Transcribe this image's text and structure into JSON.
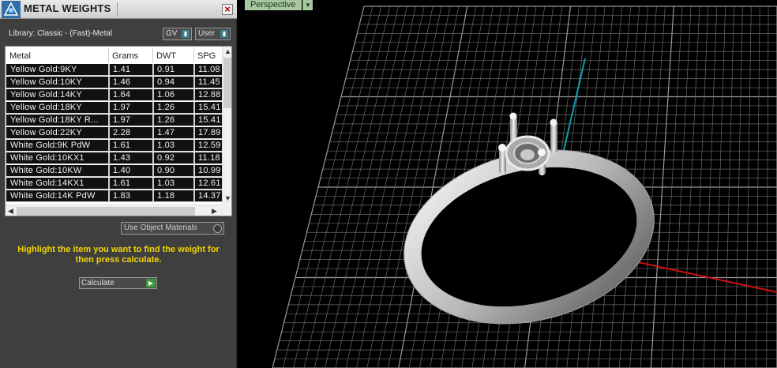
{
  "panel": {
    "title": "METAL WEIGHTS",
    "close_label": "×",
    "library_label": "Library: Classic - (Fast)-Metal",
    "gv_label": "GV",
    "user_label": "User",
    "columns": [
      "Metal",
      "Grams",
      "DWT",
      "SPG"
    ],
    "rows": [
      {
        "metal": "Yellow Gold:9KY",
        "grams": "1.41",
        "dwt": "0.91",
        "spg": "11.08"
      },
      {
        "metal": "Yellow Gold:10KY",
        "grams": "1.46",
        "dwt": "0.94",
        "spg": "11.45"
      },
      {
        "metal": "Yellow Gold:14KY",
        "grams": "1.64",
        "dwt": "1.06",
        "spg": "12.88"
      },
      {
        "metal": "Yellow Gold:18KY",
        "grams": "1.97",
        "dwt": "1.26",
        "spg": "15.41"
      },
      {
        "metal": "Yellow Gold:18KY R...",
        "grams": "1.97",
        "dwt": "1.26",
        "spg": "15.41"
      },
      {
        "metal": "Yellow Gold:22KY",
        "grams": "2.28",
        "dwt": "1.47",
        "spg": "17.89"
      },
      {
        "metal": "White Gold:9K PdW",
        "grams": "1.61",
        "dwt": "1.03",
        "spg": "12.59"
      },
      {
        "metal": "White Gold:10KX1",
        "grams": "1.43",
        "dwt": "0.92",
        "spg": "11.18"
      },
      {
        "metal": "White Gold:10KW",
        "grams": "1.40",
        "dwt": "0.90",
        "spg": "10.99"
      },
      {
        "metal": "White Gold:14KX1",
        "grams": "1.61",
        "dwt": "1.03",
        "spg": "12.61"
      },
      {
        "metal": "White Gold:14K PdW",
        "grams": "1.83",
        "dwt": "1.18",
        "spg": "14.37"
      }
    ],
    "use_object_materials": "Use Object Materials",
    "hint": "Highlight the item you want to find the weight for then press calculate.",
    "calculate_label": "Calculate"
  },
  "viewport": {
    "label": "Perspective"
  },
  "colors": {
    "hint_text": "#f2d600",
    "axis_x": "#d01010",
    "axis_z": "#10a0b0",
    "grid": "#6a6a6a",
    "calc_go": "#3c9a3c"
  },
  "icons": [
    "app-logo-icon",
    "close-icon",
    "dropdown-arrow-icon",
    "toggle-icon",
    "play-arrow-icon",
    "scroll-up-icon",
    "scroll-down-icon",
    "scroll-left-icon",
    "scroll-right-icon"
  ]
}
